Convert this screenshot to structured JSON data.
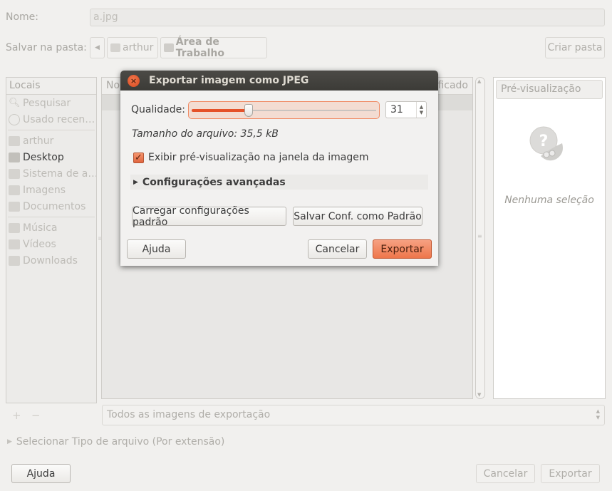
{
  "file_dialog": {
    "name_label": "Nome:",
    "name_value": "a.jpg",
    "folder_label": "Salvar na pasta:",
    "path_back_icon": "left-arrow-icon",
    "path_buttons": [
      {
        "label": "arthur",
        "icon": "home-folder-icon"
      },
      {
        "label": "Área de Trabalho",
        "icon": "desktop-folder-icon"
      }
    ],
    "create_folder_label": "Criar pasta",
    "places": {
      "header": "Locais",
      "group1": [
        {
          "label": "Pesquisar",
          "icon": "search-icon"
        },
        {
          "label": "Usado recen…",
          "icon": "recent-icon"
        }
      ],
      "group2": [
        {
          "label": "arthur",
          "icon": "home-folder-icon"
        },
        {
          "label": "Desktop",
          "icon": "desktop-icon",
          "active": true
        },
        {
          "label": "Sistema de a…",
          "icon": "drive-icon"
        },
        {
          "label": "Imagens",
          "icon": "pictures-folder-icon"
        },
        {
          "label": "Documentos",
          "icon": "documents-folder-icon"
        }
      ],
      "group3": [
        {
          "label": "Música",
          "icon": "music-folder-icon"
        },
        {
          "label": "Vídeos",
          "icon": "videos-folder-icon"
        },
        {
          "label": "Downloads",
          "icon": "downloads-folder-icon"
        }
      ],
      "add_label": "+",
      "remove_label": "−"
    },
    "file_list": {
      "col_name": "No",
      "col_modified": "ficado"
    },
    "preview": {
      "header": "Pré-visualização",
      "empty_text": "Nenhuma seleção"
    },
    "filter_value": "Todos as imagens de exportação",
    "file_type_expander": "Selecionar Tipo de arquivo (Por extensão)",
    "help_label": "Ajuda",
    "cancel_label": "Cancelar",
    "export_label": "Exportar"
  },
  "jpeg_dialog": {
    "title": "Exportar imagem como JPEG",
    "quality_label": "Qualidade:",
    "quality_value": "31",
    "quality_fraction": 0.31,
    "file_size_text": "Tamanho do arquivo: 35,5 kB",
    "preview_checkbox_label": "Exibir pré-visualização na janela da imagem",
    "preview_checked": true,
    "advanced_label": "Configurações avançadas",
    "load_defaults_label": "Carregar configurações padrão",
    "save_defaults_label": "Salvar Conf. como Padrão",
    "help_label": "Ajuda",
    "cancel_label": "Cancelar",
    "export_label": "Exportar",
    "accent_color": "#ee764b"
  }
}
